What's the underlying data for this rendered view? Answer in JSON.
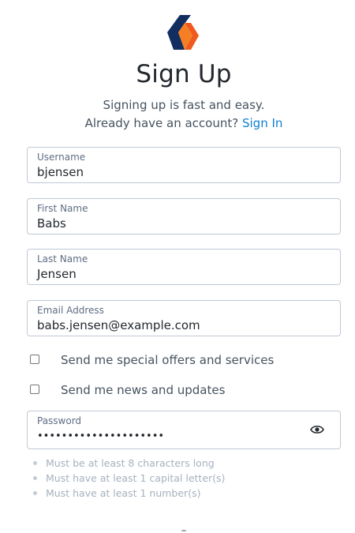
{
  "header": {
    "logo_icon": "brand-logo-icon",
    "title": "Sign Up",
    "subtitle": "Signing up is fast and easy.",
    "account_prompt": "Already have an account?",
    "sign_in_link": "Sign In"
  },
  "form": {
    "username": {
      "label": "Username",
      "value": "bjensen"
    },
    "first_name": {
      "label": "First Name",
      "value": "Babs"
    },
    "last_name": {
      "label": "Last Name",
      "value": "Jensen"
    },
    "email": {
      "label": "Email Address",
      "value": "babs.jensen@example.com"
    },
    "offers_checkbox": {
      "label": "Send me special offers and services",
      "checked": false
    },
    "news_checkbox": {
      "label": "Send me news and updates",
      "checked": false
    },
    "password": {
      "label": "Password",
      "value": "•••••••••••••••••••••",
      "toggle_icon": "eye-icon"
    }
  },
  "password_rules": [
    "Must be at least 8 characters long",
    "Must have at least 1 capital letter(s)",
    "Must have at least 1 number(s)"
  ],
  "colors": {
    "accent_link": "#0b7fd1",
    "logo_orange": "#ef5a1e",
    "logo_navy": "#122d5f"
  }
}
